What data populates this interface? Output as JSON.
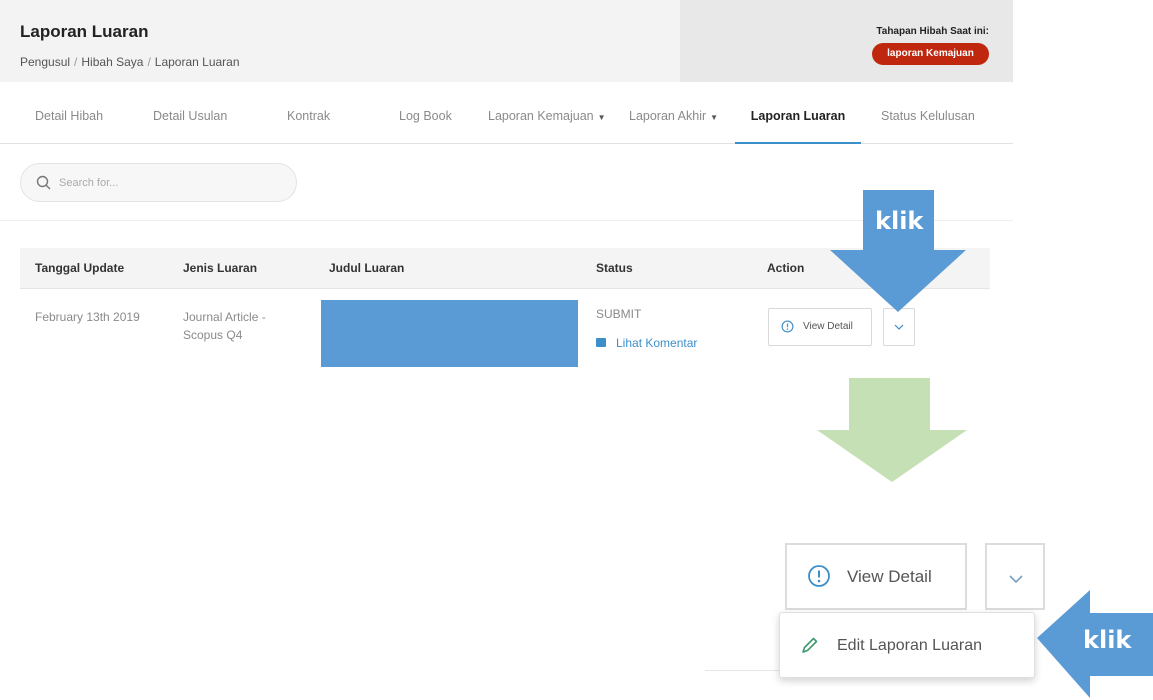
{
  "header": {
    "title": "Laporan Luaran",
    "breadcrumb": [
      "Pengusul",
      "Hibah Saya",
      "Laporan Luaran"
    ],
    "stage_label": "Tahapan Hibah Saat ini:",
    "stage_badge": "laporan Kemajuan",
    "badge_color": "#c0270f"
  },
  "tabs": [
    {
      "label": "Detail Hibah",
      "dropdown": false,
      "active": false
    },
    {
      "label": "Detail Usulan",
      "dropdown": false,
      "active": false
    },
    {
      "label": "Kontrak",
      "dropdown": false,
      "active": false
    },
    {
      "label": "Log Book",
      "dropdown": false,
      "active": false
    },
    {
      "label": "Laporan Kemajuan",
      "dropdown": true,
      "active": false
    },
    {
      "label": "Laporan Akhir",
      "dropdown": true,
      "active": false
    },
    {
      "label": "Laporan Luaran",
      "dropdown": false,
      "active": true
    },
    {
      "label": "Status Kelulusan",
      "dropdown": false,
      "active": false
    }
  ],
  "search": {
    "placeholder": "Search for..."
  },
  "table": {
    "columns": [
      "Tanggal Update",
      "Jenis Luaran",
      "Judul Luaran",
      "Status",
      "Action"
    ],
    "rows": [
      {
        "tanggal": "February 13th 2019",
        "jenis_line1": "Journal Article -",
        "jenis_line2": "Scopus Q4",
        "judul": "",
        "status": "SUBMIT",
        "comment_link": "Lihat Komentar"
      }
    ]
  },
  "actions": {
    "view_detail": "View Detail",
    "dropdown_item": "Edit Laporan Luaran"
  },
  "annotations": {
    "klik_top": "klik",
    "klik_bottom": "klik",
    "arrow_blue": "#5b9bd5",
    "arrow_green": "#c5e0b4"
  },
  "colors": {
    "accent": "#3d8fc9",
    "redaction": "#5b9bd5"
  }
}
